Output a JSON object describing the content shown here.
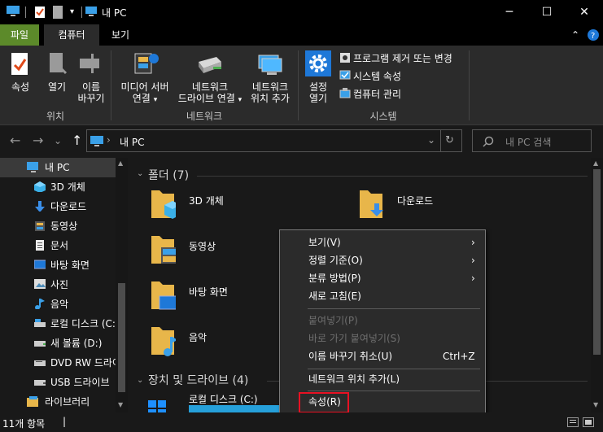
{
  "window": {
    "title": "내 PC",
    "minimize": "─",
    "maximize": "☐",
    "close": "✕"
  },
  "ribbon_tabs": [
    "파일",
    "컴퓨터",
    "보기"
  ],
  "ribbon": {
    "location_group": "위치",
    "network_group": "네트워크",
    "system_group": "시스템",
    "properties": "속성",
    "open": "열기",
    "rename_line1": "이름",
    "rename_line2": "바꾸기",
    "media_server_line1": "미디어 서버",
    "media_server_line2": "연결",
    "map_drive_line1": "네트워크",
    "map_drive_line2": "드라이브 연결",
    "add_location_line1": "네트워크",
    "add_location_line2": "위치 추가",
    "settings_line1": "설정",
    "settings_line2": "열기",
    "uninstall": "프로그램 제거 또는 변경",
    "system_props": "시스템 속성",
    "manage": "컴퓨터 관리",
    "dropdown_arrow": "▾"
  },
  "navigation": {
    "back": "←",
    "forward": "→",
    "recent": "⌄",
    "up": "↑",
    "address_sep": "›",
    "address": "내 PC",
    "address_dropdown": "⌄",
    "refresh": "↻",
    "search_placeholder": "내 PC 검색"
  },
  "nav_pane": {
    "items": [
      {
        "label": "내 PC",
        "icon": "pc-icon",
        "selected": true
      },
      {
        "label": "3D 개체",
        "icon": "3d-objects-icon"
      },
      {
        "label": "다운로드",
        "icon": "download-icon"
      },
      {
        "label": "동영상",
        "icon": "video-icon"
      },
      {
        "label": "문서",
        "icon": "document-icon"
      },
      {
        "label": "바탕 화면",
        "icon": "desktop-icon"
      },
      {
        "label": "사진",
        "icon": "pictures-icon"
      },
      {
        "label": "음악",
        "icon": "music-icon"
      },
      {
        "label": "로컬 디스크 (C:)",
        "icon": "local-disk-icon"
      },
      {
        "label": "새 볼륨 (D:)",
        "icon": "drive-icon"
      },
      {
        "label": "DVD RW 드라이브",
        "icon": "dvd-icon"
      },
      {
        "label": "USB 드라이브",
        "icon": "usb-icon"
      },
      {
        "label": "라이브러리",
        "icon": "library-icon"
      }
    ]
  },
  "content": {
    "folders_header": "폴더 (7)",
    "devices_header": "장치 및 드라이브 (4)",
    "folders": [
      {
        "label": "3D 개체"
      },
      {
        "label": "다운로드"
      },
      {
        "label": "동영상"
      },
      {
        "label": "바탕 화면"
      },
      {
        "label": "음악"
      }
    ],
    "drive": {
      "label": "로컬 디스크 (C:)"
    }
  },
  "context_menu": {
    "items": [
      {
        "label": "보기(V)",
        "submenu": true
      },
      {
        "label": "정렬 기준(O)",
        "submenu": true
      },
      {
        "label": "분류 방법(P)",
        "submenu": true
      },
      {
        "label": "새로 고침(E)"
      },
      {
        "label": "붙여넣기(P)",
        "disabled": true
      },
      {
        "label": "바로 가기 붙여넣기(S)",
        "disabled": true
      },
      {
        "label": "이름 바꾸기 취소(U)",
        "shortcut": "Ctrl+Z"
      },
      {
        "label": "네트워크 위치 추가(L)"
      },
      {
        "label": "속성(R)",
        "highlighted": true
      }
    ],
    "submenu_arrow": "›"
  },
  "status_bar": {
    "item_count": "11개 항목",
    "separator": "|"
  },
  "colors": {
    "file_tab": "#5c8a2a",
    "accent": "#1e90ff",
    "highlight_border": "#e81123",
    "folder_yellow": "#e8b64a"
  }
}
